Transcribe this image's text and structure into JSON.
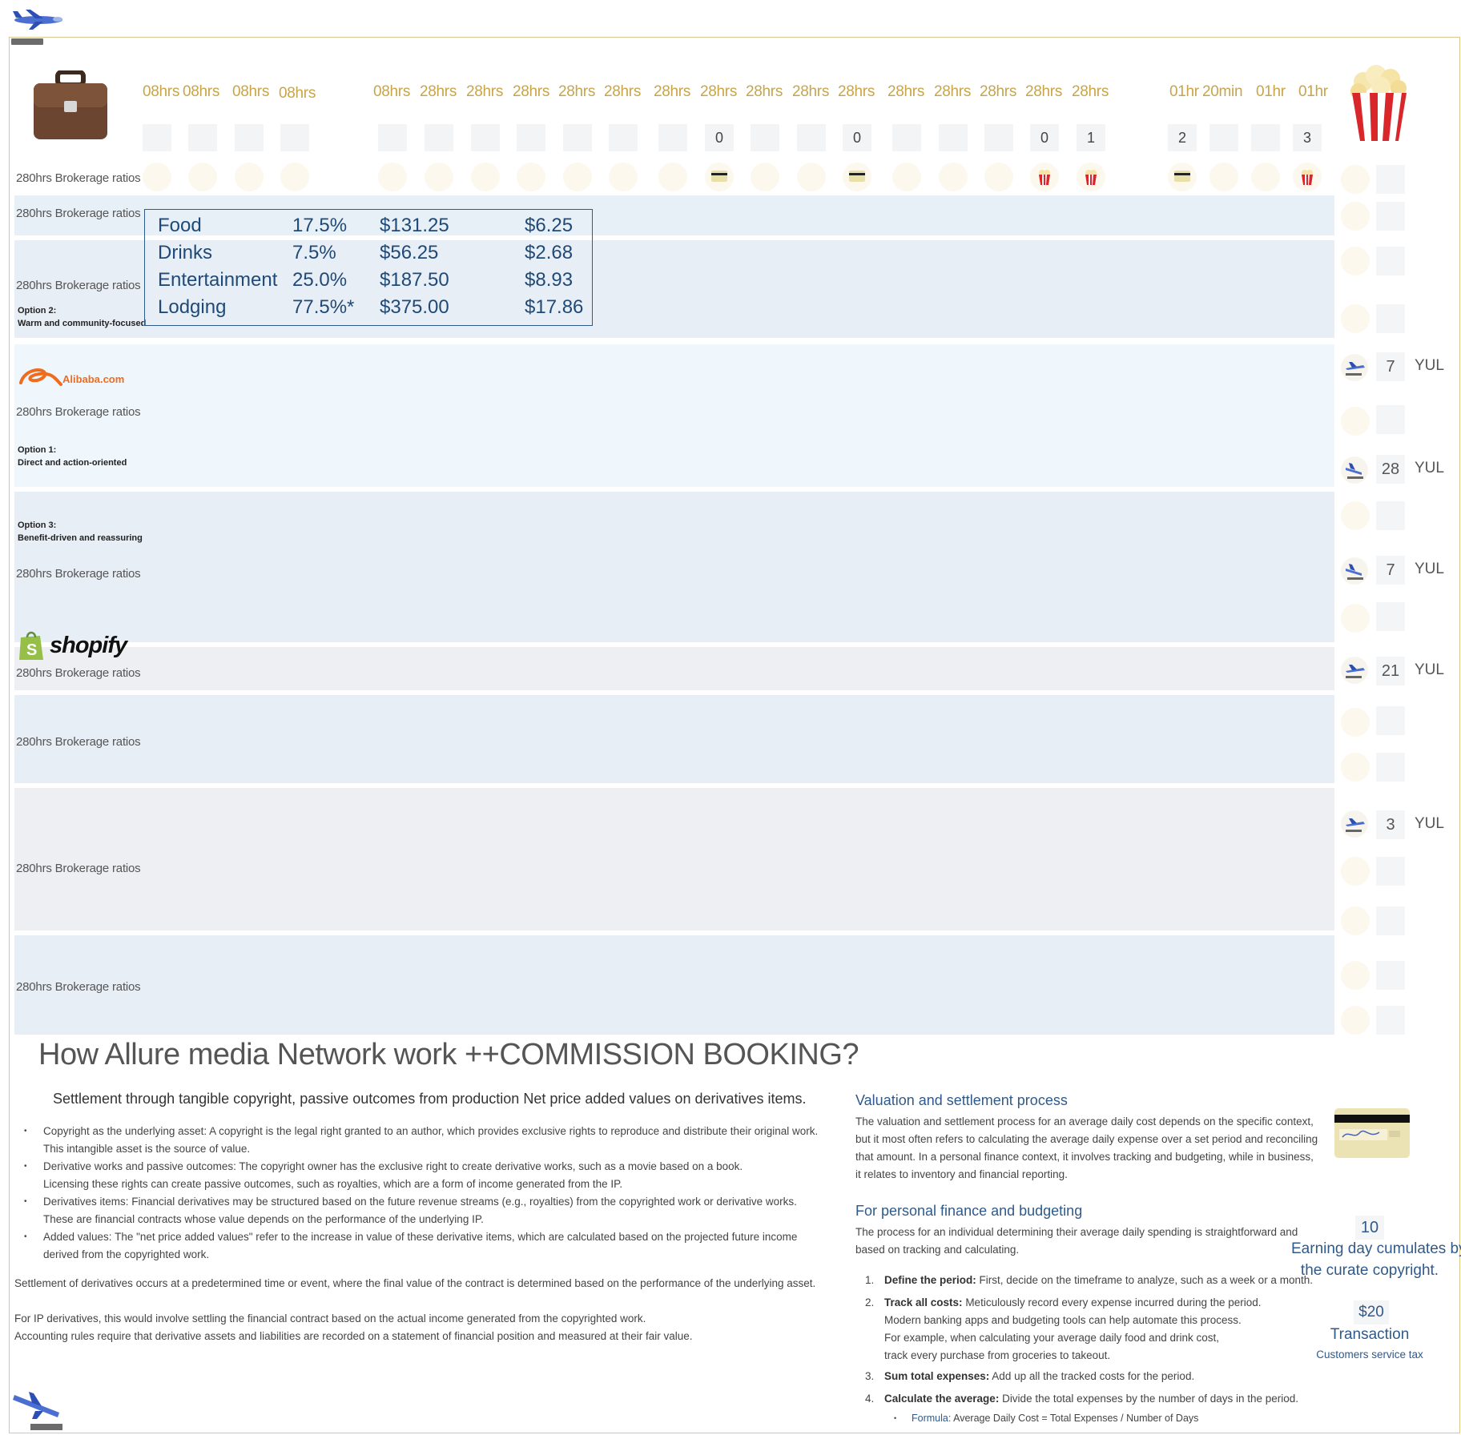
{
  "header": {
    "hour_labels": [
      "08hrs",
      "08hrs",
      "08hrs",
      "08hrs",
      "08hrs",
      "28hrs",
      "28hrs",
      "28hrs",
      "28hrs",
      "28hrs",
      "28hrs",
      "28hrs",
      "28hrs",
      "28hrs",
      "28hrs",
      "28hrs",
      "28hrs",
      "28hrs",
      "28hrs",
      "28hrs",
      "01hr",
      "20min",
      "01hr",
      "01hr"
    ],
    "counts": [
      "0",
      "0",
      "0",
      "1",
      "2",
      "3"
    ]
  },
  "rows": {
    "label": "280hrs Brokerage ratios",
    "option2_title": "Option 2:",
    "option2_desc": "Warm and community-focused",
    "option1_title": "Option 1:",
    "option1_desc": "Direct and action-oriented",
    "option3_title": "Option 3:",
    "option3_desc": "Benefit-driven and reassuring"
  },
  "brands": {
    "alibaba": "Alibaba.com",
    "shopify": "shopify"
  },
  "expense_table": [
    {
      "category": "Food",
      "pct": "17.5%",
      "total": "$131.25",
      "daily": "$6.25"
    },
    {
      "category": "Drinks",
      "pct": "7.5%",
      "total": "$56.25",
      "daily": "$2.68"
    },
    {
      "category": "Entertainment",
      "pct": "25.0%",
      "total": "$187.50",
      "daily": "$8.93"
    },
    {
      "category": "Lodging",
      "pct": "77.5%*",
      "total": "$375.00",
      "daily": "$17.86"
    }
  ],
  "side": {
    "airport": "YUL",
    "counts": [
      "7",
      "28",
      "7",
      "21",
      "3"
    ]
  },
  "article": {
    "title": "How Allure media Network work ++COMMISSION BOOKING?",
    "subtitle": "Settlement through tangible copyright, passive outcomes from production Net price added values on derivatives items.",
    "bullets": [
      [
        "Copyright as the underlying asset: A copyright is the legal right granted to an author, which provides exclusive rights to reproduce and distribute their original work.",
        "This intangible asset is the source of value."
      ],
      [
        "Derivative works and passive outcomes: The copyright owner has the exclusive right to create derivative works, such as a movie based on a book.",
        "Licensing these rights can create passive outcomes, such as royalties, which are a form of income generated from the IP."
      ],
      [
        "Derivatives items: Financial derivatives may be structured based on the future revenue streams (e.g., royalties) from the copyrighted work or derivative works.",
        "These are financial contracts whose value depends on the performance of the underlying IP."
      ],
      [
        "Added values: The \"net price added values\" refer to the increase in value of these derivative items, which are calculated based on the projected future income",
        "derived from the copyrighted work."
      ]
    ],
    "para1": "Settlement of derivatives occurs at a predetermined time or event, where the final value of the contract is determined based on the performance of the underlying asset.",
    "para2a": "For IP derivatives, this would involve settling the financial contract based on the actual income generated from the copyrighted work.",
    "para2b": "Accounting rules require that derivative assets and liabilities are recorded on a statement of financial position and measured at their fair value."
  },
  "right": {
    "h1": "Valuation and settlement process",
    "p1": [
      "The valuation and settlement process for an average daily cost depends on the specific context,",
      "but it most often refers to calculating the average daily expense over a set period and reconciling",
      "that amount. In a personal finance context, it involves tracking and budgeting, while in business,",
      "it relates to inventory and financial reporting."
    ],
    "h2": "For personal finance and budgeting",
    "p2": [
      "The process for an individual determining their average daily spending is straightforward and",
      "based on tracking and calculating."
    ],
    "steps": [
      {
        "n": "1.",
        "b": "Define the period:",
        "t": " First, decide on the timeframe to analyze, such as a week or a month.",
        "extra": []
      },
      {
        "n": "2.",
        "b": "Track all costs:",
        "t": " Meticulously record every expense incurred during the period.",
        "extra": [
          "Modern banking apps and budgeting tools can help automate this process.",
          "For example, when calculating your average daily food and drink cost,",
          "track every purchase from groceries to takeout."
        ]
      },
      {
        "n": "3.",
        "b": "Sum total expenses:",
        "t": " Add up all the tracked costs for the period.",
        "extra": []
      },
      {
        "n": "4.",
        "b": "Calculate the average:",
        "t": " Divide the total expenses by the number of days in the period.",
        "extra": []
      }
    ],
    "formula_label": "Formula:",
    "formula_text": " Average Daily Cost = Total Expenses / Number of Days"
  },
  "stats": {
    "days": "10",
    "days_line1": "Earning day cumulates by",
    "days_line2": "the curate copyright.",
    "price": "$20",
    "price_label": "Transaction",
    "price_sub": "Customers service tax"
  },
  "colors": {
    "accent_gold": "#c8a54a",
    "navy": "#2f5a8a",
    "row_blue": "#e7eff7",
    "row_grey": "#eeeff3"
  }
}
